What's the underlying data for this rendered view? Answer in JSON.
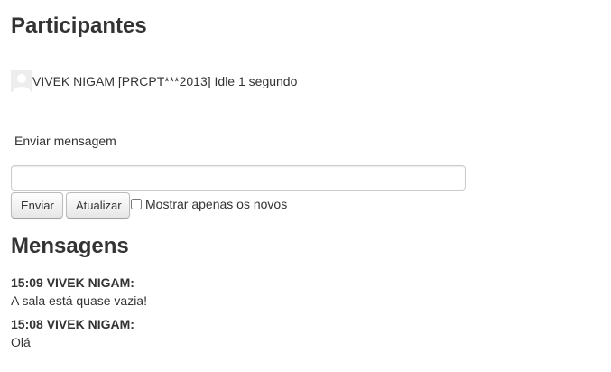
{
  "participants": {
    "title": "Participantes",
    "list": [
      {
        "name_text": "VIVEK NIGAM [PRCPT***2013] Idle 1 segundo",
        "avatar_icon": "default-user-avatar-icon"
      }
    ]
  },
  "compose": {
    "label": "Enviar mensagem",
    "input_value": "",
    "send_label": "Enviar",
    "update_label": "Atualizar",
    "new_only_label": "Mostrar apenas os novos",
    "new_only_checked": false
  },
  "messages": {
    "title": "Mensagens",
    "items": [
      {
        "header": "15:09 VIVEK NIGAM:",
        "body": "A sala está quase vazia!"
      },
      {
        "header": "15:08 VIVEK NIGAM:",
        "body": "Olá"
      }
    ]
  }
}
